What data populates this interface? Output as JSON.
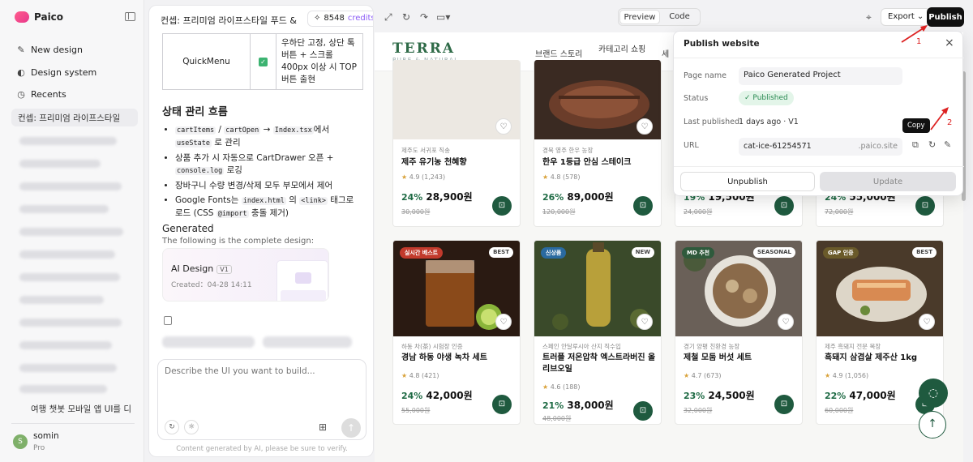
{
  "app": {
    "name": "Paico"
  },
  "sidebar": {
    "new_design": "New design",
    "design_system": "Design system",
    "recents": "Recents",
    "recent_selected": "컨셉: 프리미엄 라이프스타일",
    "recent_last": "여행 챗봇 모바일 앱 UI를 디",
    "user": {
      "name": "somin",
      "plan": "Pro",
      "initial": "S"
    }
  },
  "chat": {
    "title": "컨셉: 프리미엄 라이프스타일 푸드 &",
    "credits_count": "8548",
    "credits_label": "credits",
    "table": {
      "name": "QuickMenu",
      "desc": "우하단 고정, 상단 톡 버튼 + 스크롤 400px 이상 시 TOP 버튼 출현"
    },
    "section_title": "상태 관리 흐름",
    "bullets": [
      {
        "c1": "cartItems",
        "sep": " / ",
        "c2": "cartOpen",
        "arrow": " → ",
        "c3": "Index.tsx",
        "mid": "에서 ",
        "c4": "useState",
        "end": " 로 관리"
      },
      {
        "pre": "상품 추가 시 자동으로 CartDrawer 오픈 + ",
        "code": "console.log",
        "post": " 로깅"
      },
      {
        "text": "장바구니 수량 변경/삭제 모두 부모에서 제어"
      },
      {
        "pre": "Google Fonts는 ",
        "c1": "index.html",
        "mid": " 의 ",
        "c2": "<link>",
        "mid2": " 태그로 로드 (CSS ",
        "c3": "@import",
        "post": " 충돌 제거)"
      }
    ],
    "generated_title": "Generated",
    "generated_sub": "The following is the complete design:",
    "design_card": {
      "title": "AI Design",
      "version": "V1",
      "created": "Created：04-28 14:11"
    },
    "composer_placeholder": "Describe the UI you want to build...",
    "disclaimer": "Content generated by AI, please be sure to verify."
  },
  "toolbar": {
    "preview": "Preview",
    "code": "Code",
    "export": "Export",
    "publish": "Publish"
  },
  "site": {
    "brand": "TERRA",
    "brand_sub": "PURE & NATURAL",
    "menu": [
      "브랜드 스토리",
      "카테고리 쇼핑",
      "세"
    ],
    "row1": [
      {
        "origin": "제주도 서귀포 직송",
        "name": "제주 유기농 천혜향",
        "rating": "4.9",
        "reviews": "(1,243)",
        "disc": "24%",
        "price": "28,900원",
        "orig": "30,000원"
      },
      {
        "origin": "경북 영주 한우 농장",
        "name": "한우 1등급 안심 스테이크",
        "rating": "4.8",
        "reviews": "(578)",
        "disc": "26%",
        "price": "89,000원",
        "orig": "120,000원"
      },
      {
        "disc": "19%",
        "price": "19,500원",
        "orig": "24,000원"
      },
      {
        "disc": "24%",
        "price": "55,000원",
        "orig": "72,000원"
      }
    ],
    "row2": [
      {
        "badge": "실시간 베스트",
        "tag": "BEST",
        "origin": "하동 차(茶) 시험장 인증",
        "name": "경남 하동 야생 녹차 세트",
        "rating": "4.8",
        "reviews": "(421)",
        "disc": "24%",
        "price": "42,000원",
        "orig": "55,000원"
      },
      {
        "badge": "신상품",
        "tag": "NEW",
        "origin": "스페인 안달루시아 산지 직수입",
        "name": "트러플 저온압착 엑스트라버진 올리브오일",
        "rating": "4.6",
        "reviews": "(188)",
        "disc": "21%",
        "price": "38,000원",
        "orig": "48,000원"
      },
      {
        "badge": "MD 추천",
        "tag": "SEASONAL",
        "origin": "경기 양평 친환경 농장",
        "name": "제철 모둠 버섯 세트",
        "rating": "4.7",
        "reviews": "(673)",
        "disc": "23%",
        "price": "24,500원",
        "orig": "32,000원"
      },
      {
        "badge": "GAP 인증",
        "tag": "BEST",
        "origin": "제주 흑돼지 전문 목장",
        "name": "흑돼지 삼겹살 제주산 1kg",
        "rating": "4.9",
        "reviews": "(1,056)",
        "disc": "22%",
        "price": "47,000원",
        "orig": "60,000원"
      }
    ]
  },
  "publish_modal": {
    "title": "Publish website",
    "page_name_label": "Page name",
    "page_name": "Paico Generated Project",
    "status_label": "Status",
    "status": "Published",
    "last_published_label": "Last published",
    "last_published": "1 days ago · V1",
    "url_label": "URL",
    "url_slug": "cat-ice-61254571",
    "url_domain": ".paico.site",
    "tooltip": "Copy",
    "unpublish": "Unpublish",
    "update": "Update"
  },
  "annotations": [
    "1",
    "2"
  ]
}
